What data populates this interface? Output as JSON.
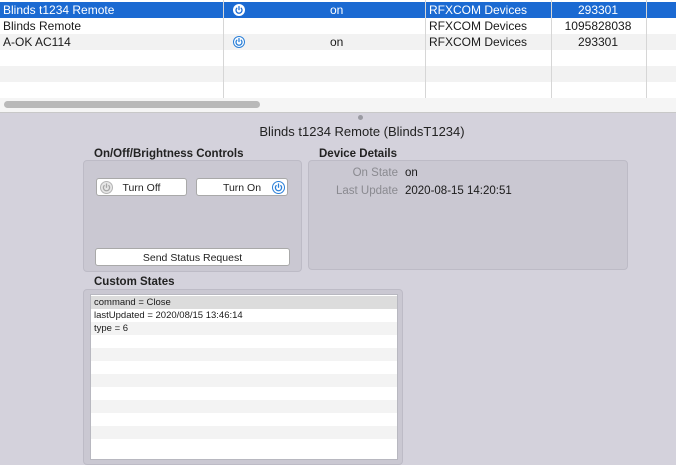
{
  "device_table": {
    "rows": [
      {
        "name": "Blinds t1234 Remote",
        "has_power_icon": true,
        "state": "on",
        "interface": "RFXCOM Devices",
        "address": "293301",
        "selected": true
      },
      {
        "name": "Blinds Remote",
        "has_power_icon": false,
        "state": "",
        "interface": "RFXCOM Devices",
        "address": "1095828038",
        "selected": false
      },
      {
        "name": "A-OK AC114",
        "has_power_icon": true,
        "state": "on",
        "interface": "RFXCOM Devices",
        "address": "293301",
        "selected": false
      }
    ]
  },
  "device_title": "Blinds t1234 Remote (BlindsT1234)",
  "controls": {
    "section_label": "On/Off/Brightness Controls",
    "turn_off_label": "Turn Off",
    "turn_on_label": "Turn On",
    "status_request_label": "Send Status Request"
  },
  "details": {
    "section_label": "Device Details",
    "on_state_label": "On State",
    "on_state_value": "on",
    "last_update_label": "Last Update",
    "last_update_value": "2020-08-15 14:20:51"
  },
  "custom_states": {
    "section_label": "Custom States",
    "items": [
      "command = Close",
      "lastUpdated = 2020/08/15 13:46:14",
      "type = 6"
    ]
  },
  "colors": {
    "selection": "#1b6ad2",
    "power_icon": "#2a7fd8",
    "panel": "#d4d2dc"
  }
}
